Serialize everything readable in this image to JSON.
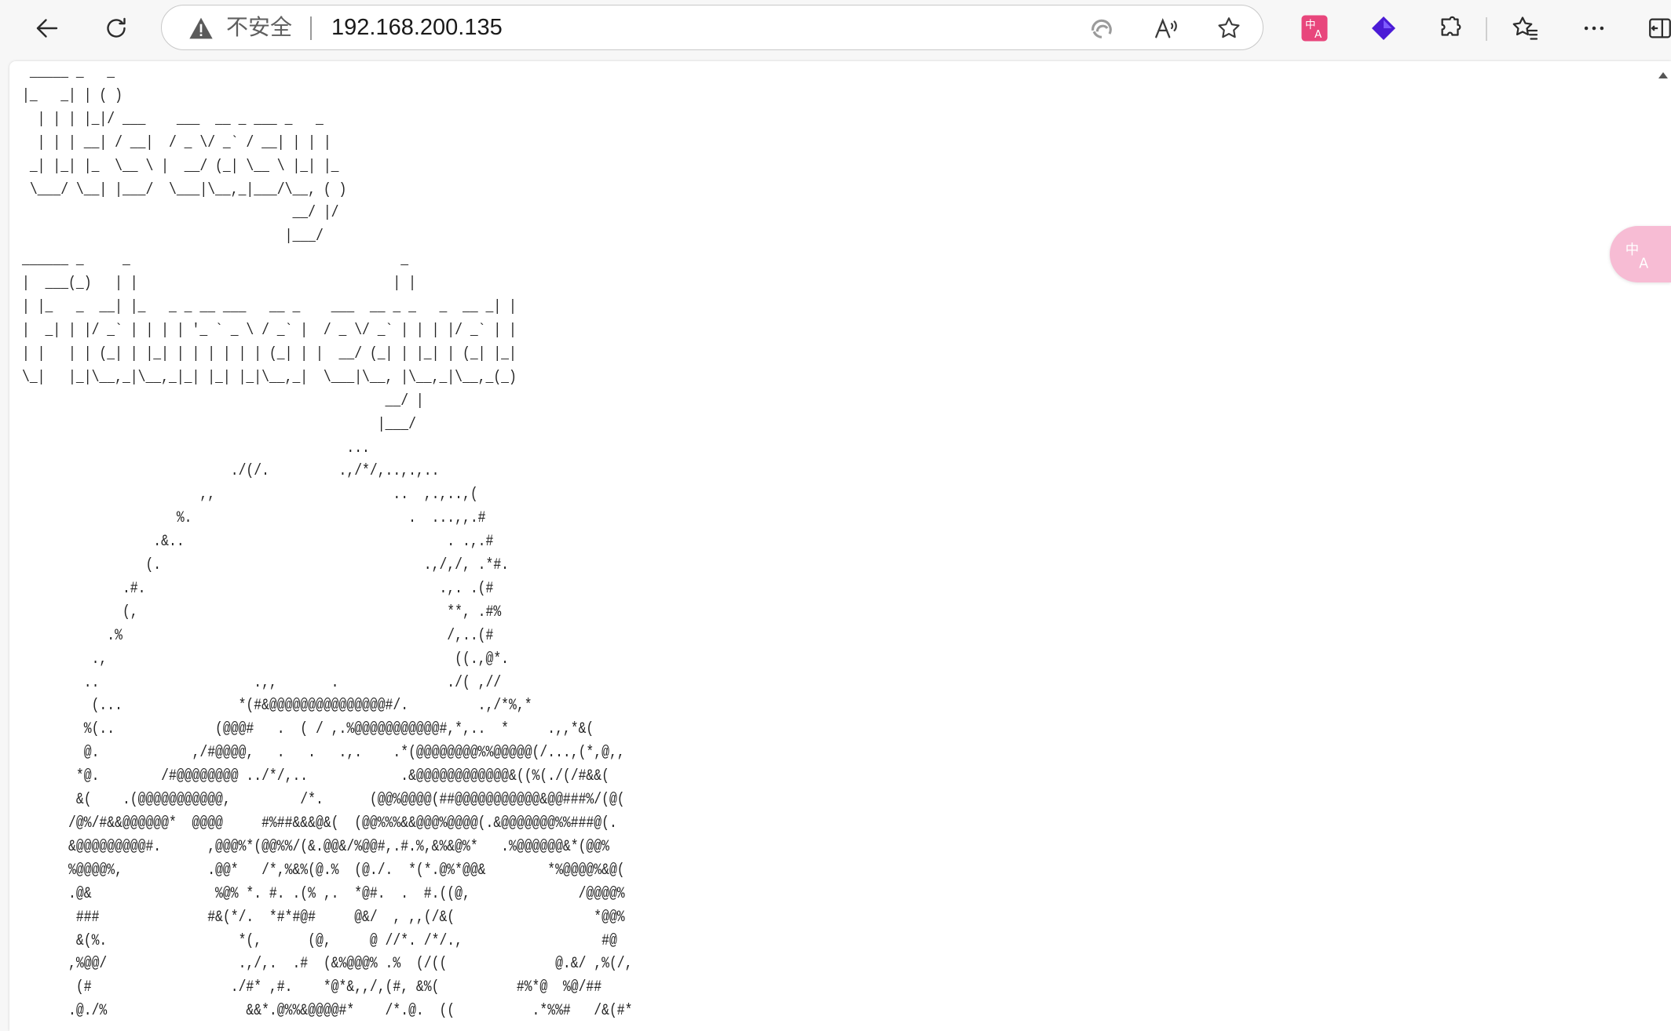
{
  "toolbar": {
    "security_label": "不安全",
    "url": "192.168.200.135",
    "icons": {
      "back": "back-arrow-icon",
      "reload": "reload-icon",
      "warning": "warning-triangle-icon",
      "edge_tracking": "tracking-prevention-icon",
      "read_aloud": "read-aloud-icon",
      "add_favorite": "star-icon",
      "translate_ext": "translate-extension-icon",
      "vpn_ext": "vpn-extension-icon",
      "extensions": "puzzle-icon",
      "favorites": "favorites-icon",
      "more": "more-icon",
      "sidebar": "sidebar-icon"
    },
    "colors": {
      "translate_ext": "#e8467c",
      "vpn_ext": "#4b1bd6",
      "float_translate": "#f7bcd4"
    }
  },
  "page": {
    "ascii_art": " _____ _   _\n|_   _| | ( )\n  | | | |_|/ ___    ___  __ _ ___ _   _\n  | | | __| / __|  / _ \\/ _` / __| | | |\n _| |_| |_  \\__ \\ |  __/ (_| \\__ \\ |_| |_\n \\___/ \\__| |___/  \\___|\\__,_|___/\\__, ( )\n                                   __/ |/\n                                  |___/\n______ _     _                                   _\n|  ___(_)   | |                                 | |\n| |_   _  __| |_   _ _ __ ___   __ _    ___  __ _ _   _  __ _| |\n|  _| | |/ _` | | | | '_ ` _ \\ / _` |  / _ \\/ _` | | | |/ _` | |\n| |   | | (_| | |_| | | | | | | (_| | |  __/ (_| | |_| | (_| |_|\n\\_|   |_|\\__,_|\\__,_|_| |_| |_|\\__,_|  \\___|\\__, |\\__,_|\\__,_(_)\n                                               __/ |\n                                              |___/\n                                          ...\n                           ./(/.         .,/*/,..,.,..\n                       ,,                       ..  ,.,..,(\n                    %.                            .  ...,,.#\n                 .&..                                  . .,.#\n                (.                                  .,/,/, .*#.\n             .#.                                      .,. .(#\n             (,                                        **, .#%\n           .%                                          /,..(#\n         .,                                             ((.,@*.\n        ..                    .,,       .              ./( ,//\n         (...               *(#&@@@@@@@@@@@@@@@#/.         .,/*%,*\n        %(..             (@@@#   .  ( / ,.%@@@@@@@@@@@#,*,..  *     .,,*&(\n        @.            ,/#@@@@,   .   .   .,.    .*(@@@@@@@@%%@@@@@(/...,(*,@,,\n       *@.        /#@@@@@@@@ ../*/,..            .&@@@@@@@@@@@@&((%(./(/#&&(\n       &(    .(@@@@@@@@@@@,         /*.      (@@%@@@@(##@@@@@@@@@@@&@@###%/(@(\n      /@%/#&&@@@@@@*  @@@@     #%##&&&@&(  (@@%%%&&@@@%@@@@(.&@@@@@@@%%###@(.\n      &@@@@@@@@@#.      ,@@@%*(@@%%/(&.@@&/%@@#,.#.%,&%&@%*   .%@@@@@@&*(@@%\n      %@@@@%,           .@@*   /*,%&%(@.%  (@./.  *(*.@%*@@&        *%@@@@%&@(\n      .@&                %@% *. #. .(% ,.  *@#.  .  #.((@,              /@@@@%\n       ###              #&(*/.  *#*#@#     @&/  , ,,(/&(                  *@@%\n       &(%.                 *(,      (@,     @ //*. /*/.,                  #@\n      ,%@@/                 .,/,.  .#  (&%@@@% .%  (/((              @.&/ ,%(/,\n       (#                  ./#* ,#.    *@*&,,/,(#, &%(          #%*@  %@/##\n      .@./%                  &&*.@%%&@@@@#*    /*.@.  ((          .*%%#   /&(#*"
  }
}
